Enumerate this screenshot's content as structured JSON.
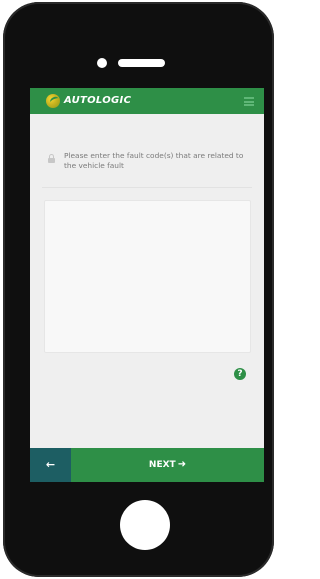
{
  "header": {
    "brand": "AUTOLOGIC",
    "logo_icon": "autologic-logo-icon",
    "menu_icon": "hamburger-menu-icon"
  },
  "form": {
    "lock_icon": "lock-icon",
    "prompt": "Please enter the fault code(s) that are related to the vehicle fault",
    "fault_codes_value": "",
    "fault_codes_placeholder": "",
    "help_label": "?"
  },
  "footer": {
    "back_label": "←",
    "next_label": "NEXT",
    "next_arrow": "➜"
  },
  "colors": {
    "brand_green": "#2e8f47",
    "back_teal": "#1d5e63",
    "screen_bg": "#efefef",
    "device_frame": "#0f0f0f"
  }
}
